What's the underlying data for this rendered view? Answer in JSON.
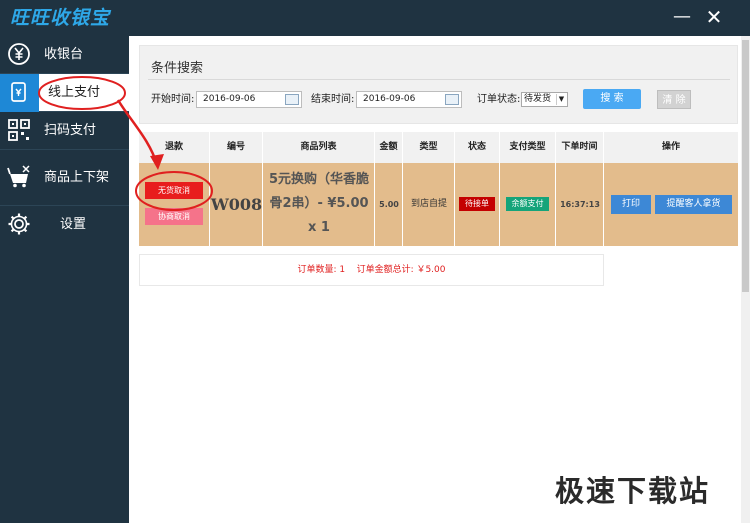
{
  "app": {
    "title": "旺旺收银宝"
  },
  "window": {
    "minimize": "—",
    "close": "✕"
  },
  "sidebar": {
    "items": [
      {
        "label": "收银台",
        "icon": "yen-icon"
      },
      {
        "label": "线上支付",
        "icon": "mobile-payment-icon",
        "active": true
      },
      {
        "label": "扫码支付",
        "icon": "qrcode-icon"
      },
      {
        "label": "商品上下架",
        "icon": "goods-shelf-icon"
      },
      {
        "label": "设置",
        "icon": "gear-icon"
      }
    ]
  },
  "search": {
    "title": "条件搜索",
    "start_label": "开始时间:",
    "start_value": "2016-09-06",
    "end_label": "结束时间:",
    "end_value": "2016-09-06",
    "status_label": "订单状态:",
    "status_value": "待发货",
    "search_button": "搜 索",
    "clear_button": "清 除"
  },
  "table": {
    "headers": [
      "退款",
      "编号",
      "商品列表",
      "金额",
      "类型",
      "状态",
      "支付类型",
      "下单时间",
      "操作"
    ],
    "rows": [
      {
        "refund_buttons": [
          "无货取消",
          "协商取消"
        ],
        "code": "W008",
        "goods": "5元换购（华香脆骨2串）- ¥5.00 x 1",
        "amount": "5.00",
        "type": "到店自提",
        "status": "待接单",
        "pay_type": "余额支付",
        "time": "16:37:13",
        "actions": [
          "打印",
          "提醒客人拿货"
        ]
      }
    ]
  },
  "summary": {
    "count_label": "订单数量: 1",
    "total_label": "订单金额总计: ￥5.00"
  },
  "colors": {
    "sidebar_bg": "#1f3341",
    "accent_blue": "#1e88d6",
    "row_bg": "#e3bc8c",
    "annotation_red": "#e02020"
  },
  "watermark": "极速下载站"
}
